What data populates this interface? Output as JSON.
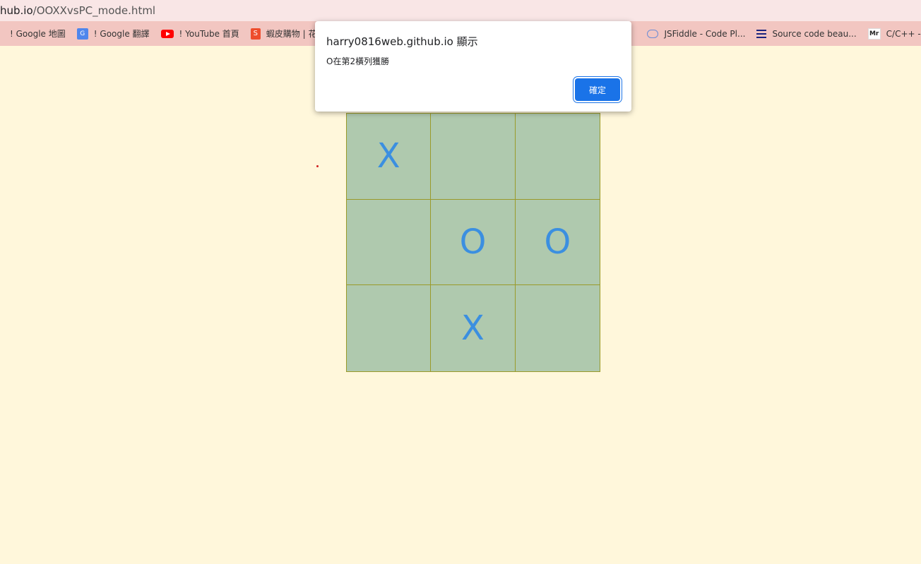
{
  "browser": {
    "url_host": "hub.io",
    "url_path": "/OOXXvsPC_mode.html",
    "bookmarks": [
      {
        "label": "! Google 地圖",
        "icon": "map-icon"
      },
      {
        "label": "! Google 翻譯",
        "icon": "translate-icon"
      },
      {
        "label": "! YouTube 首頁",
        "icon": "youtube-icon"
      },
      {
        "label": "蝦皮購物 | 花得",
        "icon": "shopee-icon"
      },
      {
        "label": "JSFiddle - Code Pl...",
        "icon": "jsfiddle-icon"
      },
      {
        "label": "Source code beau...",
        "icon": "lines-icon"
      },
      {
        "label": "C/C++ - String",
        "icon": "mr-icon"
      }
    ]
  },
  "board": {
    "cells": [
      "X",
      "",
      "",
      "",
      "O",
      "O",
      "",
      "X",
      ""
    ],
    "mark_color": "#3b8fe0",
    "cell_color": "#afc9ae"
  },
  "dialog": {
    "title": "harry0816web.github.io 顯示",
    "message": "O在第2橫列獲勝",
    "ok_label": "確定"
  }
}
